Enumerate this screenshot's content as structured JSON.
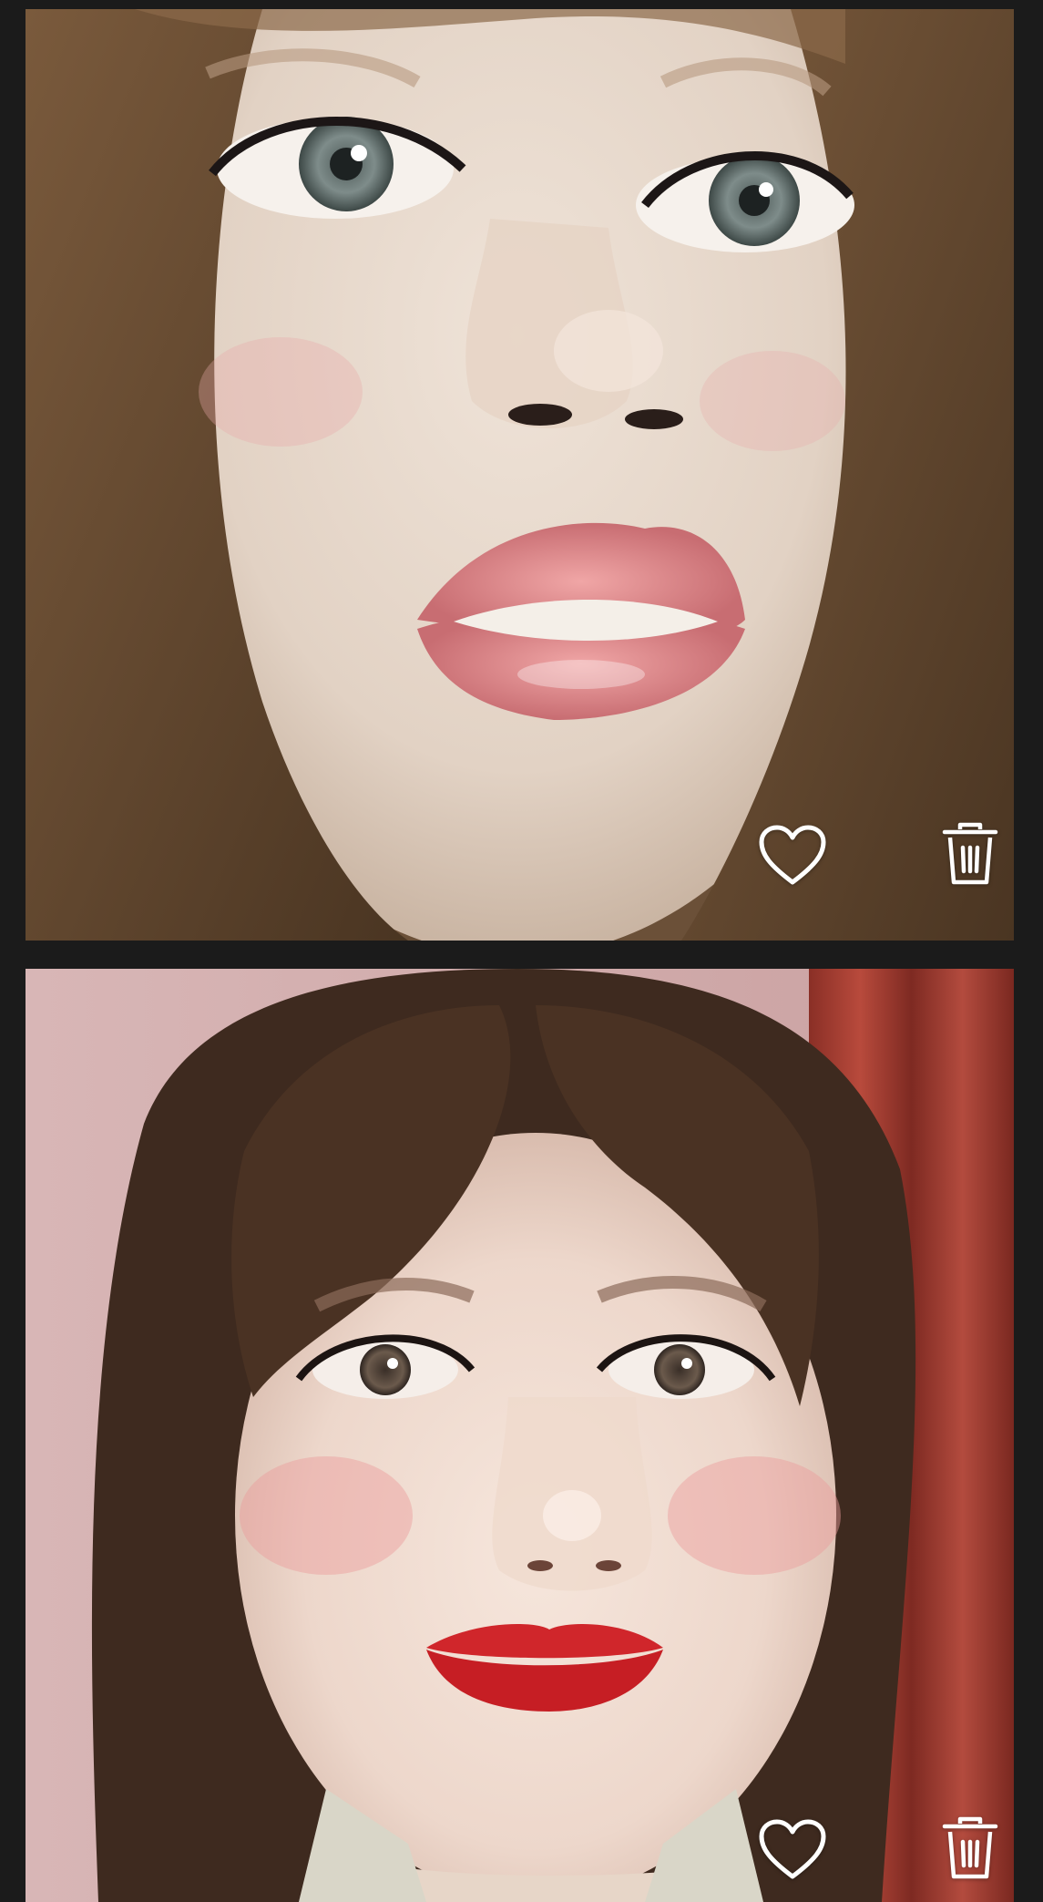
{
  "feed": {
    "posts": [
      {
        "photo_description": "",
        "like_icon": "heart-outline-icon",
        "delete_icon": "trash-icon"
      },
      {
        "photo_description": "",
        "like_icon": "heart-outline-icon",
        "delete_icon": "trash-icon"
      }
    ]
  },
  "colors": {
    "background": "#1b1b1b",
    "icon": "#ffffff"
  }
}
